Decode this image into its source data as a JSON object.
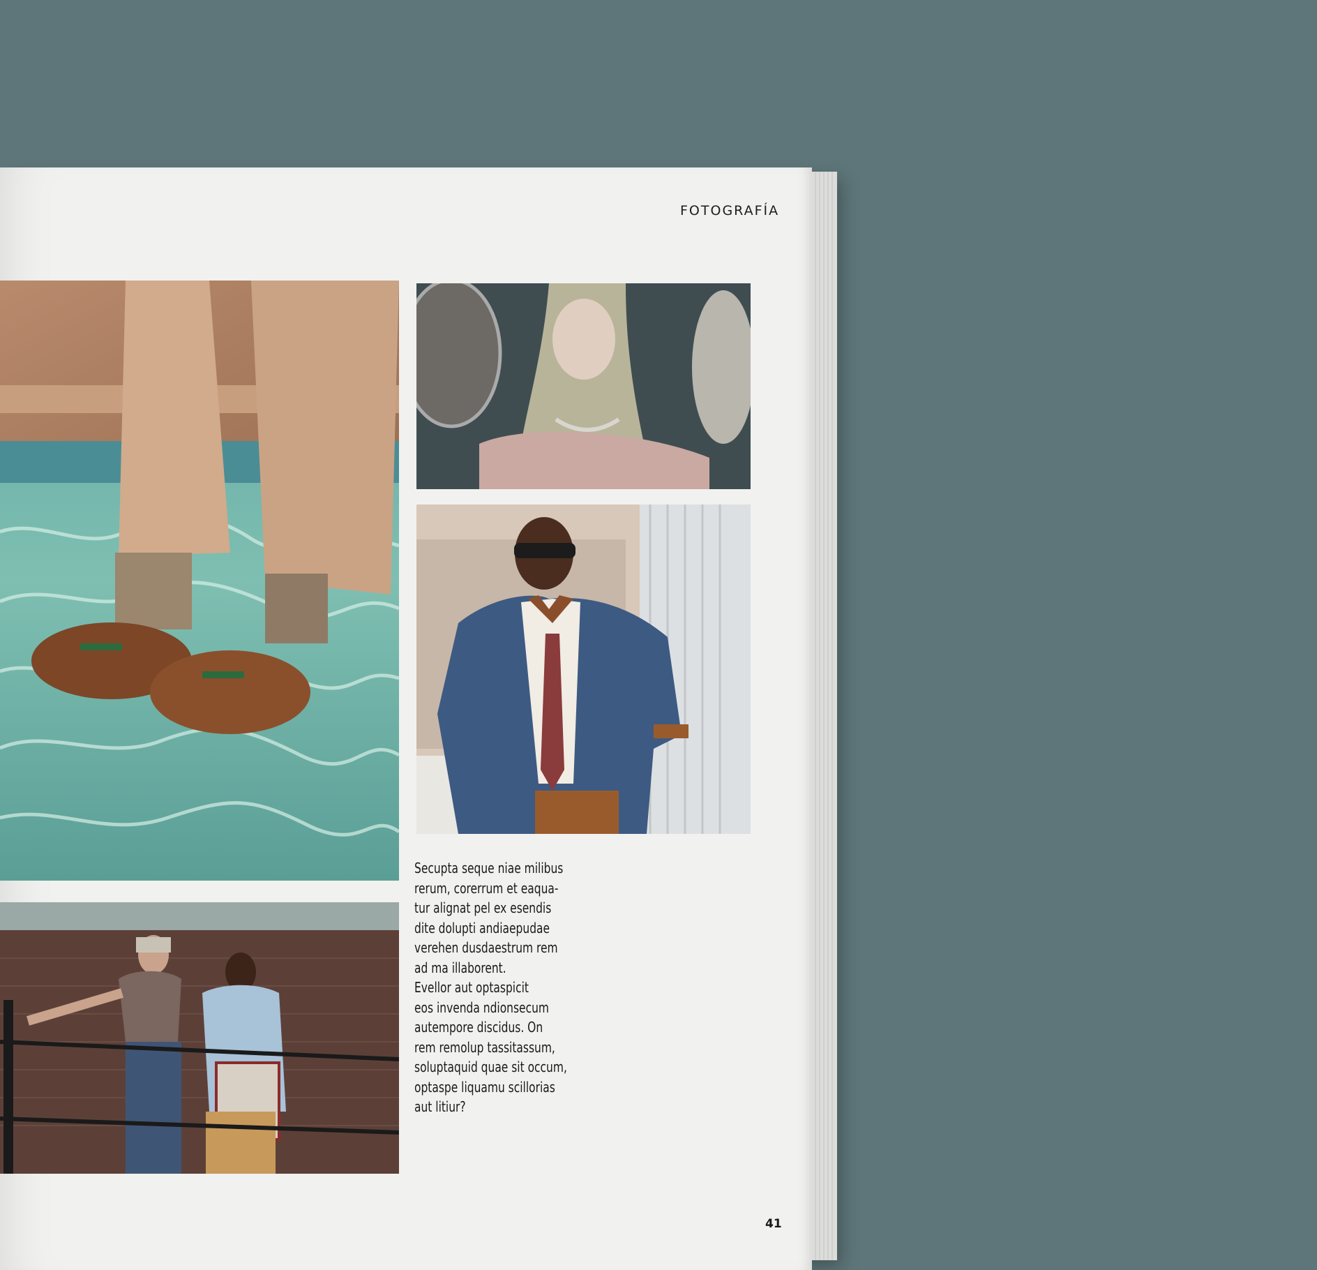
{
  "page": {
    "section_label": "FOTOGRAFÍA",
    "page_number": "41",
    "body_lines": [
      "Secupta seque niae milibus",
      "rerum, corerrum et eaqua-",
      "tur alignat pel ex esendis",
      "dite dolupti andiaepudae",
      "verehen dusdaestrum rem",
      "ad ma illaborent.",
      "Evellor aut optaspicit",
      "eos invenda ndionsecum",
      "autempore discidus. On",
      "rem remolup tassitassum,",
      "soluptaquid quae sit occum,",
      "optaspe liquamu scillorias",
      "aut litiur?"
    ]
  },
  "colors": {
    "background": "#5e7679",
    "paper": "#f1f1ef",
    "text": "#1a1a1a"
  }
}
